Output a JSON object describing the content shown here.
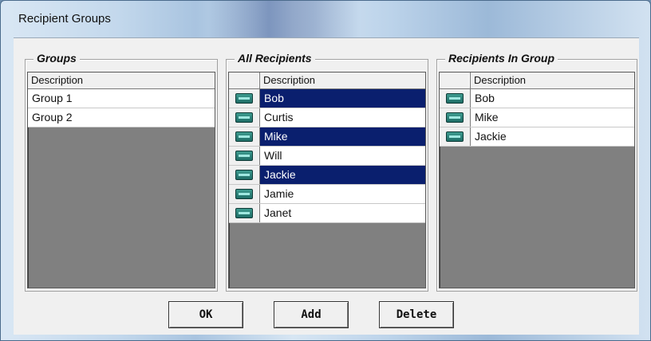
{
  "window": {
    "title": "Recipient Groups"
  },
  "groups": {
    "title": "Groups",
    "column": "Description",
    "rows": [
      {
        "label": "Group 1"
      },
      {
        "label": "Group 2"
      }
    ]
  },
  "all_recipients": {
    "title": "All Recipients",
    "column": "Description",
    "rows": [
      {
        "label": "Bob",
        "selected": true,
        "icon": "recipient-icon"
      },
      {
        "label": "Curtis",
        "selected": false,
        "icon": "recipient-icon"
      },
      {
        "label": "Mike",
        "selected": true,
        "icon": "recipient-icon"
      },
      {
        "label": "Will",
        "selected": false,
        "icon": "recipient-icon"
      },
      {
        "label": "Jackie",
        "selected": true,
        "icon": "recipient-icon"
      },
      {
        "label": "Jamie",
        "selected": false,
        "icon": "recipient-icon"
      },
      {
        "label": "Janet",
        "selected": false,
        "icon": "recipient-icon"
      }
    ]
  },
  "recipients_in_group": {
    "title": "Recipients In Group",
    "column": "Description",
    "rows": [
      {
        "label": "Bob",
        "icon": "recipient-icon"
      },
      {
        "label": "Mike",
        "icon": "recipient-icon"
      },
      {
        "label": "Jackie",
        "icon": "recipient-icon"
      }
    ]
  },
  "buttons": {
    "ok": "OK",
    "add": "Add",
    "delete": "Delete"
  },
  "colors": {
    "selection": "#0a1f6e",
    "grid_background": "#808080",
    "dialog_face": "#f0f0f0"
  }
}
